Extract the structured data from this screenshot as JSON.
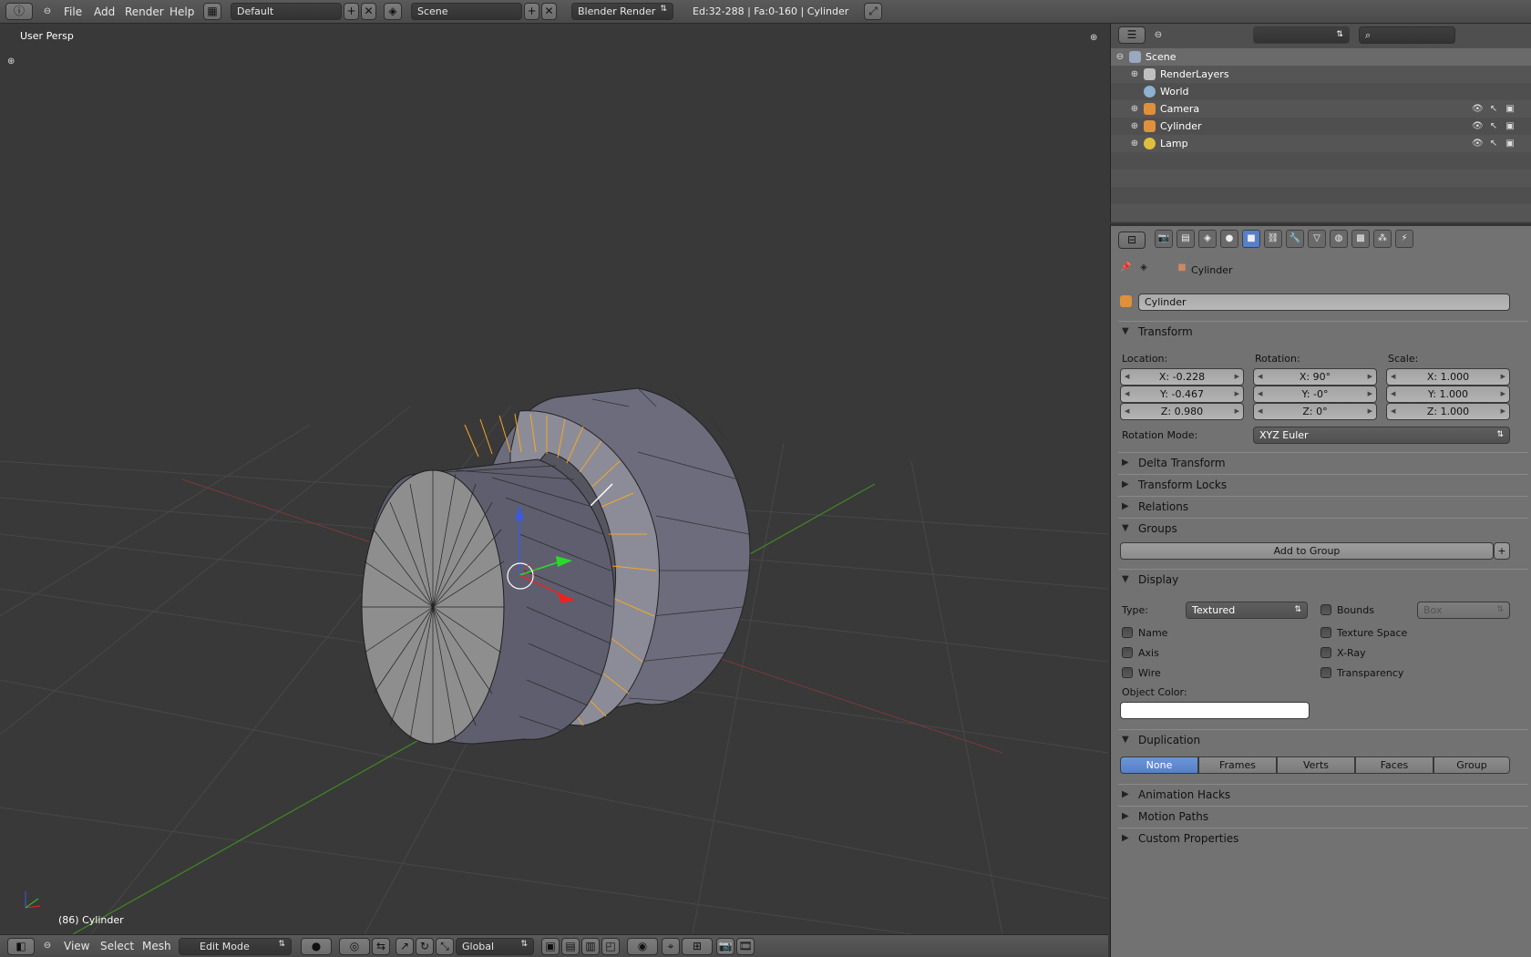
{
  "topbar": {
    "menus": [
      "File",
      "Add",
      "Render",
      "Help"
    ],
    "screen_layout": "Default",
    "scene": "Scene",
    "render_engine": "Blender Render",
    "stats": "Ed:32-288 | Fa:0-160 | Cylinder"
  },
  "viewport": {
    "view_label": "User Persp",
    "object_label": "(86) Cylinder"
  },
  "bottombar": {
    "menus": [
      "View",
      "Select",
      "Mesh"
    ],
    "mode": "Edit Mode",
    "orientation": "Global"
  },
  "outliner": {
    "rows": [
      {
        "label": "Scene"
      },
      {
        "label": "RenderLayers"
      },
      {
        "label": "World"
      },
      {
        "label": "Camera"
      },
      {
        "label": "Cylinder"
      },
      {
        "label": "Lamp"
      }
    ]
  },
  "properties": {
    "breadcrumb": "Cylinder",
    "object_name": "Cylinder",
    "transform": {
      "title": "Transform",
      "location_label": "Location:",
      "rotation_label": "Rotation:",
      "scale_label": "Scale:",
      "loc_x": "X: -0.228",
      "loc_y": "Y: -0.467",
      "loc_z": "Z: 0.980",
      "rot_x": "X: 90°",
      "rot_y": "Y: -0°",
      "rot_z": "Z: 0°",
      "scale_x": "X: 1.000",
      "scale_y": "Y: 1.000",
      "scale_z": "Z: 1.000",
      "rotation_mode_label": "Rotation Mode:",
      "rotation_mode": "XYZ Euler"
    },
    "panels": {
      "delta": "Delta Transform",
      "locks": "Transform Locks",
      "relations": "Relations",
      "groups": "Groups",
      "add_to_group": "Add to Group",
      "display": "Display",
      "duplication": "Duplication",
      "anim_hacks": "Animation Hacks",
      "motion_paths": "Motion Paths",
      "custom_props": "Custom Properties"
    },
    "display": {
      "type_label": "Type:",
      "type_value": "Textured",
      "bounds": "Bounds",
      "bounds_type": "Box",
      "name": "Name",
      "texture_space": "Texture Space",
      "axis": "Axis",
      "xray": "X-Ray",
      "wire": "Wire",
      "transparency": "Transparency",
      "object_color_label": "Object Color:"
    },
    "duplication": [
      "None",
      "Frames",
      "Verts",
      "Faces",
      "Group"
    ]
  },
  "colors": {
    "selected_edge": "#f5a623",
    "grid_x": "#8a3a3a",
    "grid_y": "#4a8a2a",
    "active_tab": "#5680c8"
  }
}
